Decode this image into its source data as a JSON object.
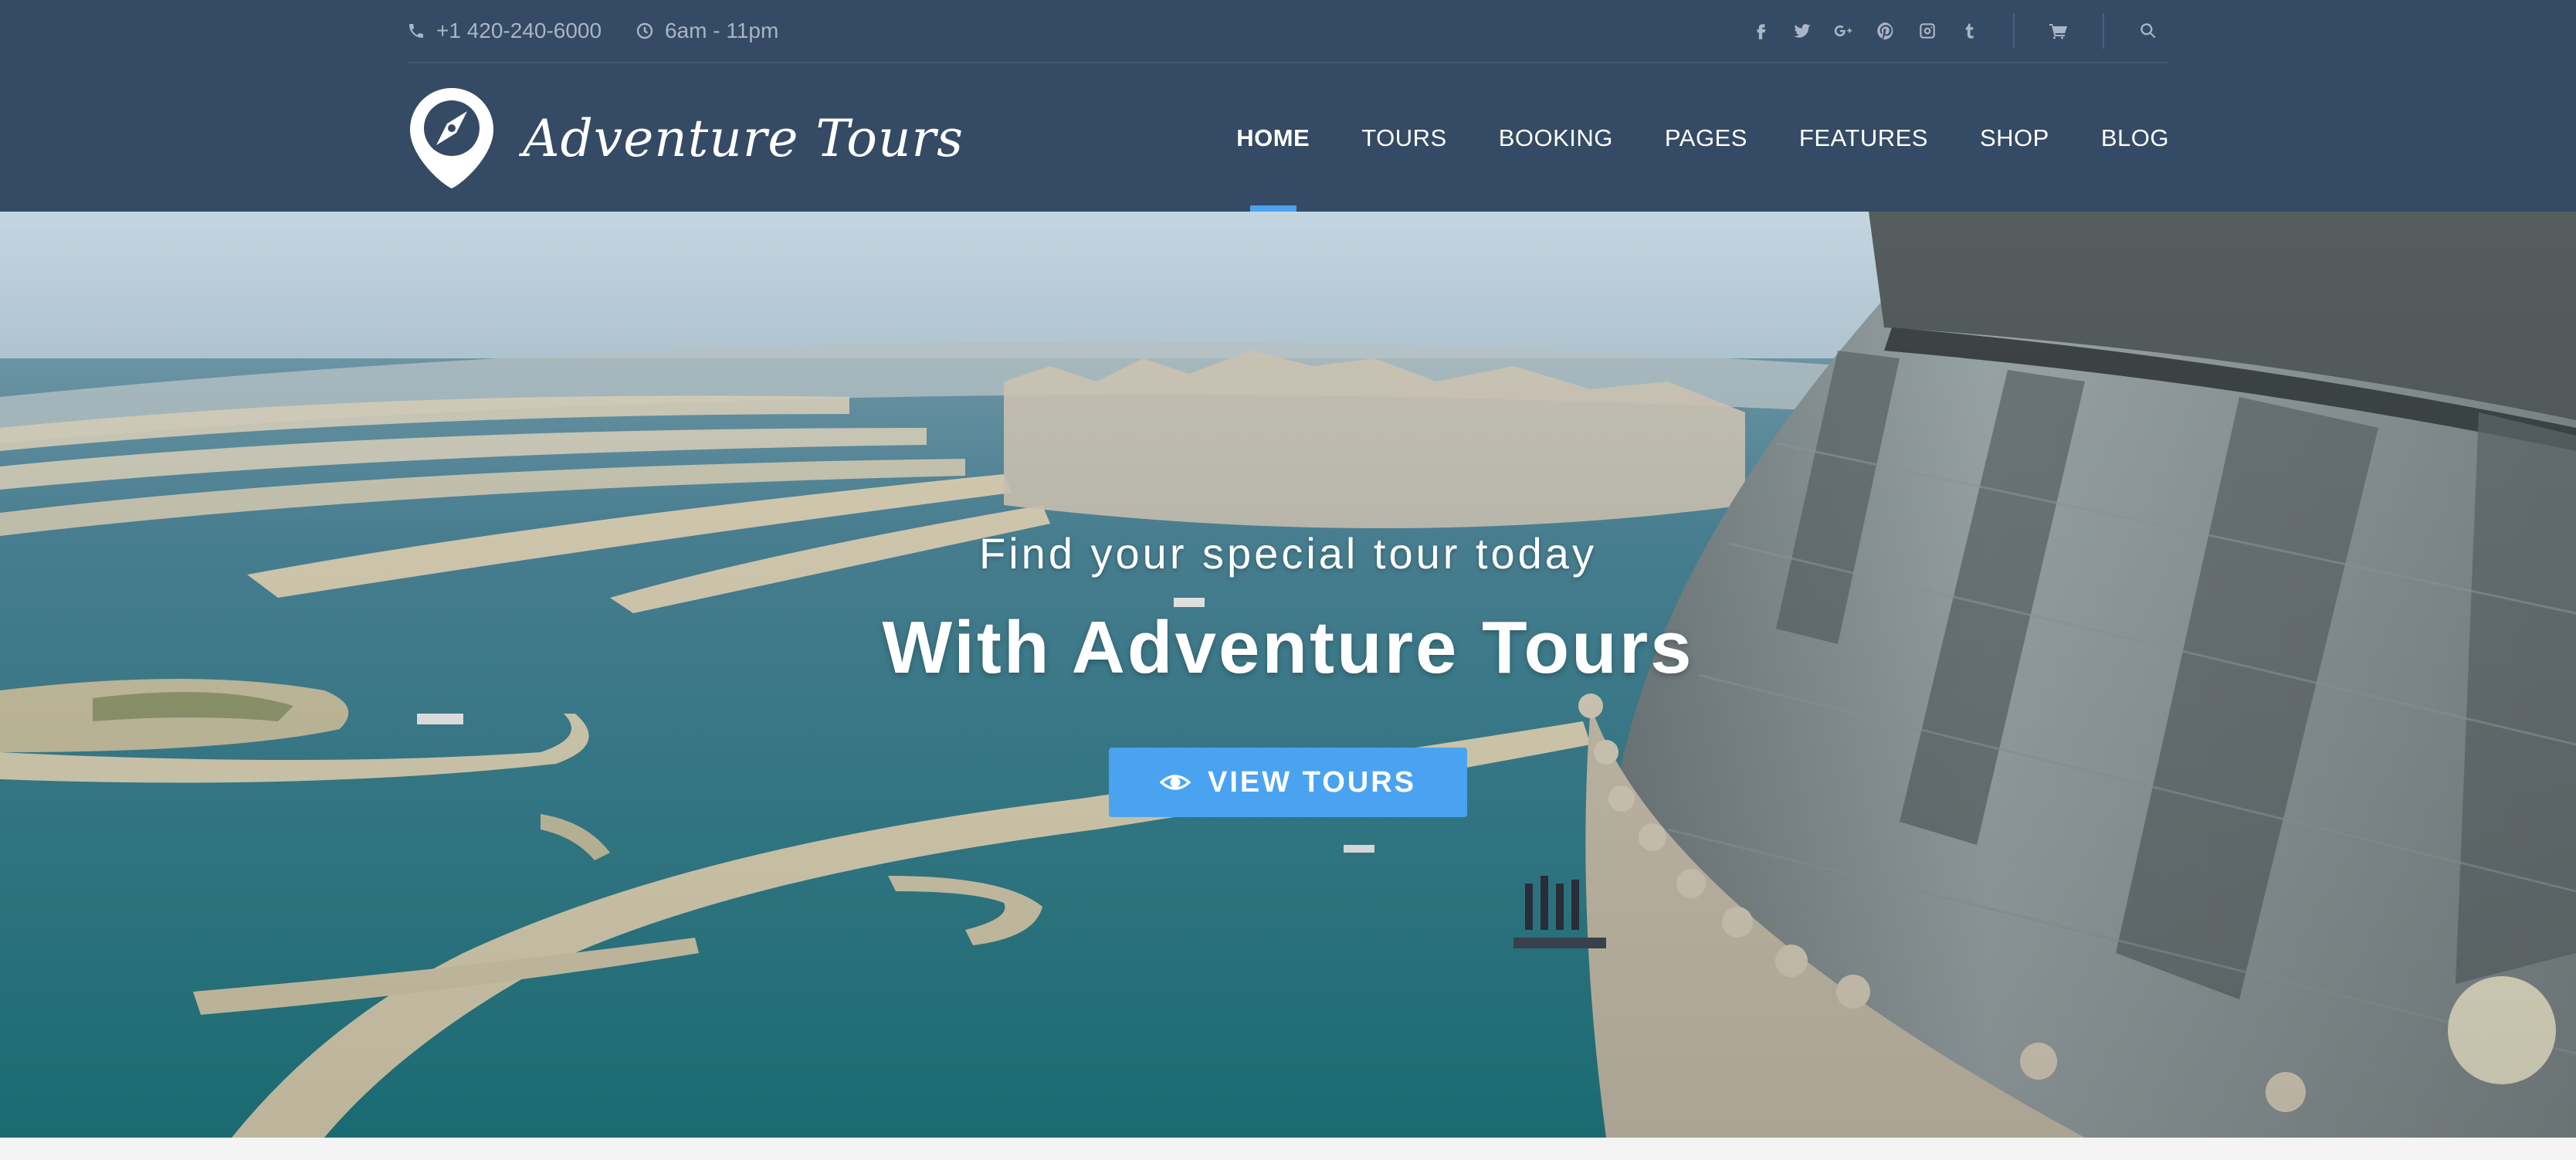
{
  "topbar": {
    "phone": "+1 420-240-6000",
    "hours": "6am - 11pm",
    "socials": [
      {
        "icon": "facebook-icon",
        "glyph": "f"
      },
      {
        "icon": "twitter-icon",
        "glyph": "twitter"
      },
      {
        "icon": "google-plus-icon",
        "glyph": "G+"
      },
      {
        "icon": "pinterest-icon",
        "glyph": "pinterest"
      },
      {
        "icon": "instagram-icon",
        "glyph": "instagram"
      },
      {
        "icon": "tumblr-icon",
        "glyph": "t"
      }
    ],
    "cart_icon": "cart-icon",
    "search_icon": "search-icon"
  },
  "brand": {
    "name": "Adventure Tours",
    "logo_icon": "compass-pin-icon"
  },
  "nav": {
    "items": [
      {
        "label": "HOME",
        "active": true
      },
      {
        "label": "TOURS"
      },
      {
        "label": "BOOKING"
      },
      {
        "label": "PAGES"
      },
      {
        "label": "FEATURES"
      },
      {
        "label": "SHOP"
      },
      {
        "label": "BLOG"
      }
    ]
  },
  "hero": {
    "subtitle": "Find your special tour today",
    "title": "With Adventure Tours",
    "button_label": "VIEW TOURS",
    "button_icon": "eye-icon"
  },
  "colors": {
    "header_bg": "#354a64",
    "accent": "#4aa3f0",
    "topbar_text": "#a9b5c4"
  }
}
